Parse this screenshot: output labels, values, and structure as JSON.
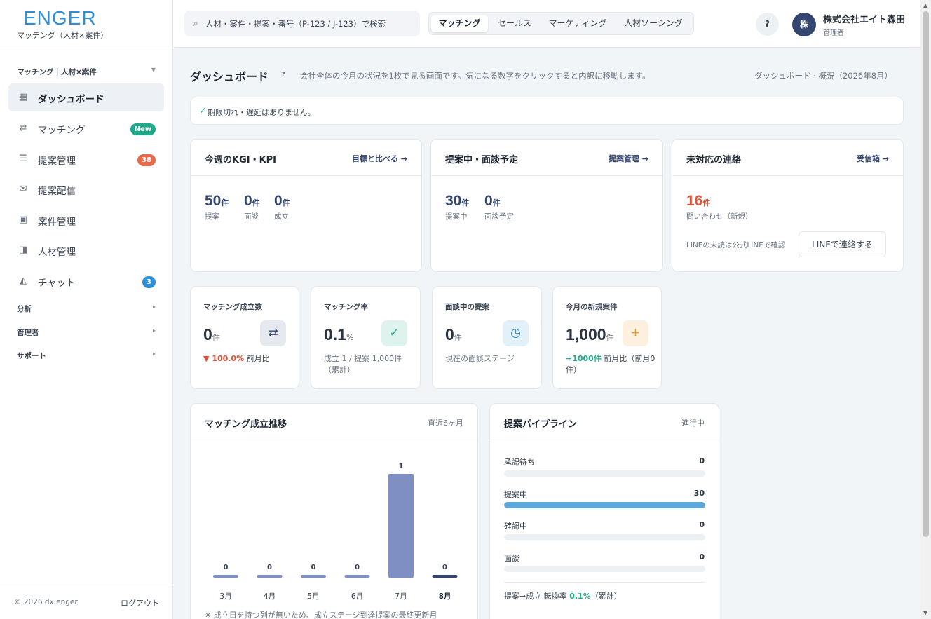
{
  "brand": {
    "logo": "ENGER",
    "subtitle": "マッチング（人材×案件）",
    "logo_color": "#2f8fd6"
  },
  "sidebar": {
    "section": "マッチング｜人材×案件",
    "items": [
      {
        "label": "ダッシュボード",
        "icon": "grid-icon"
      },
      {
        "label": "マッチング",
        "icon": "swap-icon",
        "badge": "New"
      },
      {
        "label": "提案管理",
        "icon": "list-icon",
        "badge": "38"
      },
      {
        "label": "提案配信",
        "icon": "mail-icon"
      },
      {
        "label": "案件管理",
        "icon": "square-icon"
      },
      {
        "label": "人材管理",
        "icon": "person-card-icon"
      },
      {
        "label": "チャット",
        "icon": "chat-icon",
        "badge": "3"
      }
    ],
    "groups": [
      "分析",
      "管理者",
      "サポート"
    ],
    "footer": {
      "copyright": "© 2026 dx.enger",
      "logout": "ログアウト"
    }
  },
  "topbar": {
    "search_placeholder": "人材・案件・提案・番号（P-123 / J-123）で検索",
    "tabs": [
      "マッチング",
      "セールス",
      "マーケティング",
      "人材ソーシング"
    ],
    "help": "?",
    "user": {
      "avatar": "株",
      "name": "株式会社エイト森田",
      "role": "管理者"
    }
  },
  "page": {
    "title": "ダッシュボード",
    "help": "?",
    "description": "会社全体の今月の状況を1枚で見る画面です。気になる数字をクリックすると内訳に移動します。",
    "breadcrumb": "ダッシュボード · 概況（2026年8月）"
  },
  "alert": {
    "icon": "✓",
    "text": "期限切れ・遅延はありません。"
  },
  "kgi": {
    "title": "今週のKGI・KPI",
    "link": "目標と比べる →",
    "metrics": [
      {
        "value": "50",
        "unit": "件",
        "label": "提案"
      },
      {
        "value": "0",
        "unit": "件",
        "label": "面談"
      },
      {
        "value": "0",
        "unit": "件",
        "label": "成立"
      }
    ]
  },
  "proposals": {
    "title": "提案中・面談予定",
    "link": "提案管理 →",
    "metrics": [
      {
        "value": "30",
        "unit": "件",
        "label": "提案中"
      },
      {
        "value": "0",
        "unit": "件",
        "label": "面談予定"
      }
    ]
  },
  "contacts": {
    "title": "未対応の連絡",
    "link": "受信箱 →",
    "value": "16",
    "unit": "件",
    "label": "問い合わせ（新規）",
    "note": "LINEの未読は公式LINEで確認",
    "button": "LINEで連絡する",
    "accent": "#e0533a"
  },
  "mini_cards": [
    {
      "title": "マッチング成立数",
      "value": "0",
      "unit": "件",
      "icon": "⇄",
      "icon_name": "swap-icon",
      "change": "▼ 100.0%",
      "sub": " 前月比"
    },
    {
      "title": "マッチング率",
      "value": "0.1",
      "unit": "%",
      "icon": "✓",
      "icon_name": "check-icon",
      "sub": "成立 1 / 提案 1,000件（累計）"
    },
    {
      "title": "面談中の提案",
      "value": "0",
      "unit": "件",
      "icon": "◷",
      "icon_name": "clock-icon",
      "sub": "現在の面談ステージ"
    },
    {
      "title": "今月の新規案件",
      "value": "1,000",
      "unit": "件",
      "icon": "+",
      "icon_name": "plus-icon",
      "change": "+1000件",
      "sub": " 前月比（前月0件）"
    }
  ],
  "trend": {
    "title": "マッチング成立推移",
    "range": "直近6ヶ月",
    "note": "※ 成立日を持つ列が無いため、成立ステージ到達提案の最終更新月"
  },
  "chart_data": {
    "type": "bar",
    "categories": [
      "3月",
      "4月",
      "5月",
      "6月",
      "7月",
      "8月"
    ],
    "values": [
      0,
      0,
      0,
      0,
      1,
      0
    ],
    "data_labels": [
      "0",
      "0",
      "0",
      "0",
      "1",
      "0"
    ],
    "highlight": "8月",
    "ylim": [
      0,
      1
    ],
    "bar_color": "#7f8fc4",
    "highlight_color": "#34466f"
  },
  "pipeline": {
    "title": "提案パイプライン",
    "status": "進行中",
    "stages": [
      {
        "label": "承認待ち",
        "value": "0",
        "fraction": 0
      },
      {
        "label": "提案中",
        "value": "30",
        "fraction": 1
      },
      {
        "label": "確認中",
        "value": "0",
        "fraction": 0
      },
      {
        "label": "面談",
        "value": "0",
        "fraction": 0
      }
    ],
    "conversion_label": "提案→成立 転換率 ",
    "conversion_value": "0.1%",
    "conversion_suffix": "（累計）"
  }
}
